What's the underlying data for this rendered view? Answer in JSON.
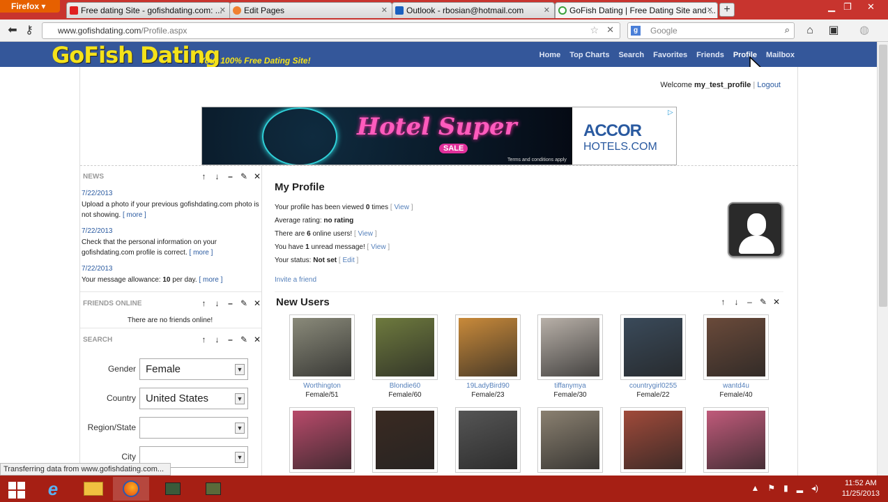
{
  "browser": {
    "menu_label": "Firefox",
    "tabs": [
      {
        "title": "Free dating Site - gofishdating.com: ...",
        "active": false
      },
      {
        "title": "Edit Pages",
        "active": false
      },
      {
        "title": "Outlook - rbosian@hotmail.com",
        "active": false
      },
      {
        "title": "GoFish Dating | Free Dating Site and ...",
        "active": true
      }
    ],
    "new_tab": "+",
    "url_host": "www.gofishdating.com",
    "url_path": "/Profile.aspx",
    "search_placeholder": "Google",
    "status": "Transferring data from www.gofishdating.com..."
  },
  "site": {
    "logo": "GoFish Dating",
    "tagline": "Your 100% Free Dating Site!",
    "nav": [
      "Home",
      "Top Charts",
      "Search",
      "Favorites",
      "Friends",
      "Profile",
      "Mailbox"
    ],
    "nav_current": "Profile",
    "welcome_prefix": "Welcome",
    "username": "my_test_profile",
    "separator": "|",
    "logout": "Logout"
  },
  "ad": {
    "headline": "Hotel Super",
    "sale": "SALE",
    "terms": "Terms and conditions apply",
    "brand": "ACCOR",
    "brand_sub": "HOTELS.COM"
  },
  "panel_controls": [
    "↑",
    "↓",
    "–",
    "✎",
    "✕"
  ],
  "news": {
    "title": "NEWS",
    "items": [
      {
        "date": "7/22/2013",
        "text": "Upload a photo if your previous gofishdating.com photo is not showing.",
        "more": "[ more ]"
      },
      {
        "date": "7/22/2013",
        "text": "Check that the personal information on your gofishdating.com profile is correct.",
        "more": "[ more ]"
      },
      {
        "date": "7/22/2013",
        "text_prefix": "Your message allowance:",
        "bold": "10",
        "text_suffix": "per day.",
        "more": "[ more ]"
      }
    ]
  },
  "friends_online": {
    "title": "FRIENDS ONLINE",
    "empty": "There are no friends online!"
  },
  "search": {
    "title": "SEARCH",
    "fields": [
      {
        "label": "Gender",
        "value": "Female"
      },
      {
        "label": "Country",
        "value": "United States"
      },
      {
        "label": "Region/State",
        "value": ""
      },
      {
        "label": "City",
        "value": ""
      }
    ]
  },
  "profile": {
    "title": "My Profile",
    "lines": [
      {
        "prefix": "Your profile has been viewed",
        "bold": "0",
        "suffix": "times",
        "link": "View"
      },
      {
        "prefix": "Average rating:",
        "bold": "no rating",
        "suffix": "",
        "link": ""
      },
      {
        "prefix": "There are",
        "bold": "6",
        "suffix": "online users!",
        "link": "View"
      },
      {
        "prefix": "You have",
        "bold": "1",
        "suffix": "unread message!",
        "link": "View"
      },
      {
        "prefix": "Your status:",
        "bold": "Not set",
        "suffix": "",
        "link": "Edit"
      }
    ],
    "invite": "Invite a friend"
  },
  "new_users": {
    "title": "New Users",
    "users": [
      {
        "name": "Worthington",
        "info": "Female/51",
        "color": "#8a8a7a"
      },
      {
        "name": "Blondie60",
        "info": "Female/60",
        "color": "#6e7a3e"
      },
      {
        "name": "19LadyBird90",
        "info": "Female/23",
        "color": "#c98a3a"
      },
      {
        "name": "tiffanymya",
        "info": "Female/30",
        "color": "#b8b0a8"
      },
      {
        "name": "countrygirl0255",
        "info": "Female/22",
        "color": "#3a4a5a"
      },
      {
        "name": "wantd4u",
        "info": "Female/40",
        "color": "#6a4a3a"
      },
      {
        "name": "",
        "info": "",
        "color": "#b84a6a"
      },
      {
        "name": "",
        "info": "",
        "color": "#3a2a22"
      },
      {
        "name": "",
        "info": "",
        "color": "#555555"
      },
      {
        "name": "",
        "info": "",
        "color": "#8a8070"
      },
      {
        "name": "",
        "info": "",
        "color": "#a04a3a"
      },
      {
        "name": "",
        "info": "",
        "color": "#c05a7a"
      }
    ]
  },
  "taskbar": {
    "time": "11:52 AM",
    "date": "11/25/2013"
  },
  "colors": {
    "site_header": "#34579a",
    "logo": "#f4e21a",
    "link": "#5580bb",
    "taskbar": "#a61f14"
  }
}
